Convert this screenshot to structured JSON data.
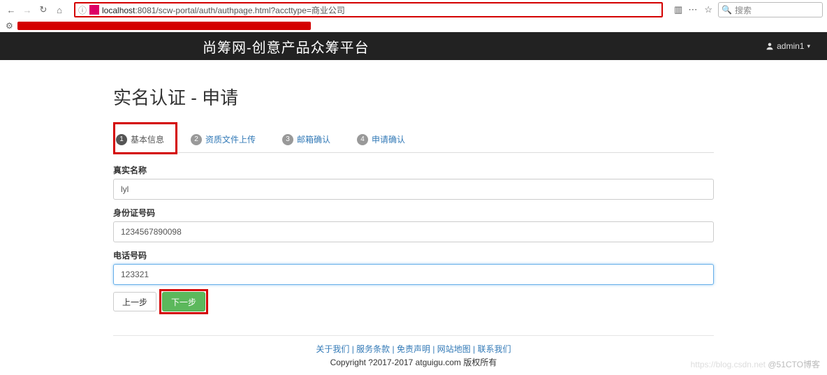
{
  "browser": {
    "url_host": "localhost",
    "url_rest": ":8081/scw-portal/auth/authpage.html?accttype=商业公司",
    "search_placeholder": "搜索"
  },
  "topnav": {
    "brand": "尚筹网-创意产品众筹平台",
    "username": "admin1"
  },
  "page": {
    "title": "实名认证 - 申请"
  },
  "tabs": [
    {
      "num": "1",
      "label": "基本信息",
      "active": true
    },
    {
      "num": "2",
      "label": "资质文件上传",
      "active": false
    },
    {
      "num": "3",
      "label": "邮箱确认",
      "active": false
    },
    {
      "num": "4",
      "label": "申请确认",
      "active": false
    }
  ],
  "form": {
    "real_name_label": "真实名称",
    "real_name_value": "lyl",
    "id_label": "身份证号码",
    "id_value": "1234567890098",
    "phone_label": "电话号码",
    "phone_value": "123321"
  },
  "buttons": {
    "prev": "上一步",
    "next": "下一步"
  },
  "footer": {
    "links": [
      "关于我们",
      "服务条款",
      "免责声明",
      "网站地图",
      "联系我们"
    ],
    "copyright": "Copyright ?2017-2017 atguigu.com 版权所有"
  },
  "watermark": {
    "left": "https://blog.csdn.net",
    "right": "@51CTO博客"
  }
}
